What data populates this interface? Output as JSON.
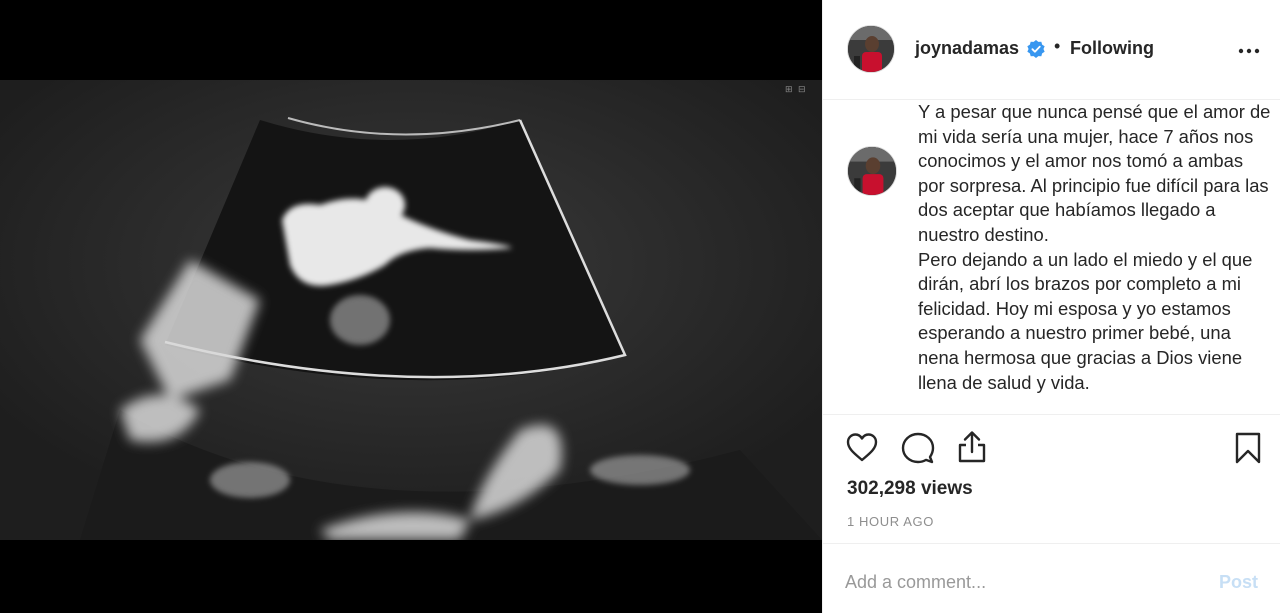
{
  "post": {
    "username": "joynadamas",
    "verified": true,
    "follow_status": "Following",
    "caption": "Y a pesar que nunca pensé que el amor de mi vida sería una mujer, hace 7 años nos conocimos y el amor nos tomó a ambas por sorpresa. Al principio fue difícil para las dos aceptar que habíamos llegado a nuestro destino.\nPero dejando a un lado el miedo y el que dirán, abrí los brazos por completo a mi felicidad. Hoy mi esposa y yo estamos esperando a nuestro primer bebé, una nena hermosa que gracias a Dios viene llena de salud y vida.",
    "views": "302,298 views",
    "time": "1 HOUR AGO"
  },
  "comment": {
    "placeholder": "Add a comment...",
    "post_label": "Post"
  },
  "icons": {
    "like": "heart-icon",
    "comment": "comment-icon",
    "share": "share-icon",
    "save": "bookmark-icon",
    "more": "more-options-icon",
    "verified": "verified-badge-icon"
  },
  "colors": {
    "verified": "#3897f0",
    "text": "#262626",
    "muted": "#8e8e8e",
    "post_disabled": "#c7dff5",
    "border": "#efefef"
  }
}
